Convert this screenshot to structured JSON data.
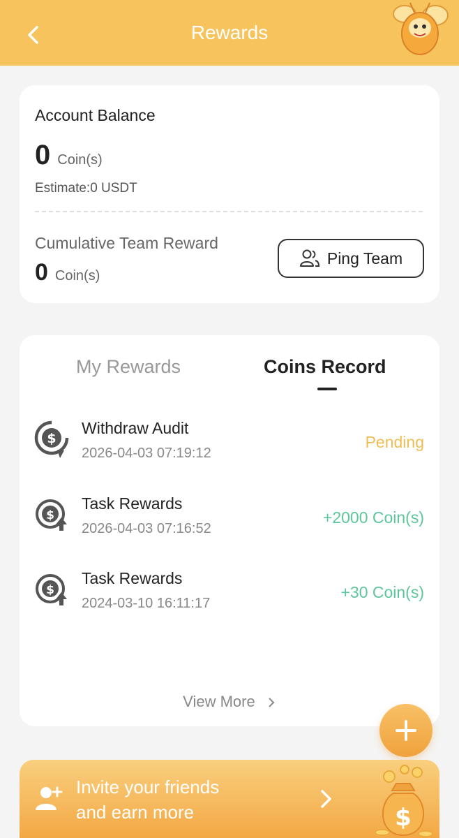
{
  "header": {
    "title": "Rewards"
  },
  "balance": {
    "label": "Account Balance",
    "value": "0",
    "unit": "Coin(s)",
    "estimate": "Estimate:0 USDT",
    "cumulative_label": "Cumulative Team Reward",
    "cumulative_value": "0",
    "cumulative_unit": "Coin(s)",
    "ping_button": "Ping Team"
  },
  "tabs": [
    {
      "label": "My Rewards",
      "active": false
    },
    {
      "label": "Coins Record",
      "active": true
    }
  ],
  "records": [
    {
      "icon": "withdraw-audit-icon",
      "title": "Withdraw Audit",
      "date": "2026-04-03 07:19:12",
      "amount": "Pending",
      "status_color": "#f0bd55"
    },
    {
      "icon": "task-reward-icon",
      "title": "Task Rewards",
      "date": "2026-04-03 07:16:52",
      "amount": "+2000 Coin(s)",
      "status_color": "#5cc79a"
    },
    {
      "icon": "task-reward-icon",
      "title": "Task Rewards",
      "date": "2024-03-10 16:11:17",
      "amount": "+30 Coin(s)",
      "status_color": "#5cc79a"
    }
  ],
  "view_more": "View More",
  "invite": {
    "line1": "Invite your friends",
    "line2": "and earn more"
  },
  "colors": {
    "brand": "#f7c35c",
    "pending": "#f0bd55",
    "positive": "#5cc79a"
  }
}
